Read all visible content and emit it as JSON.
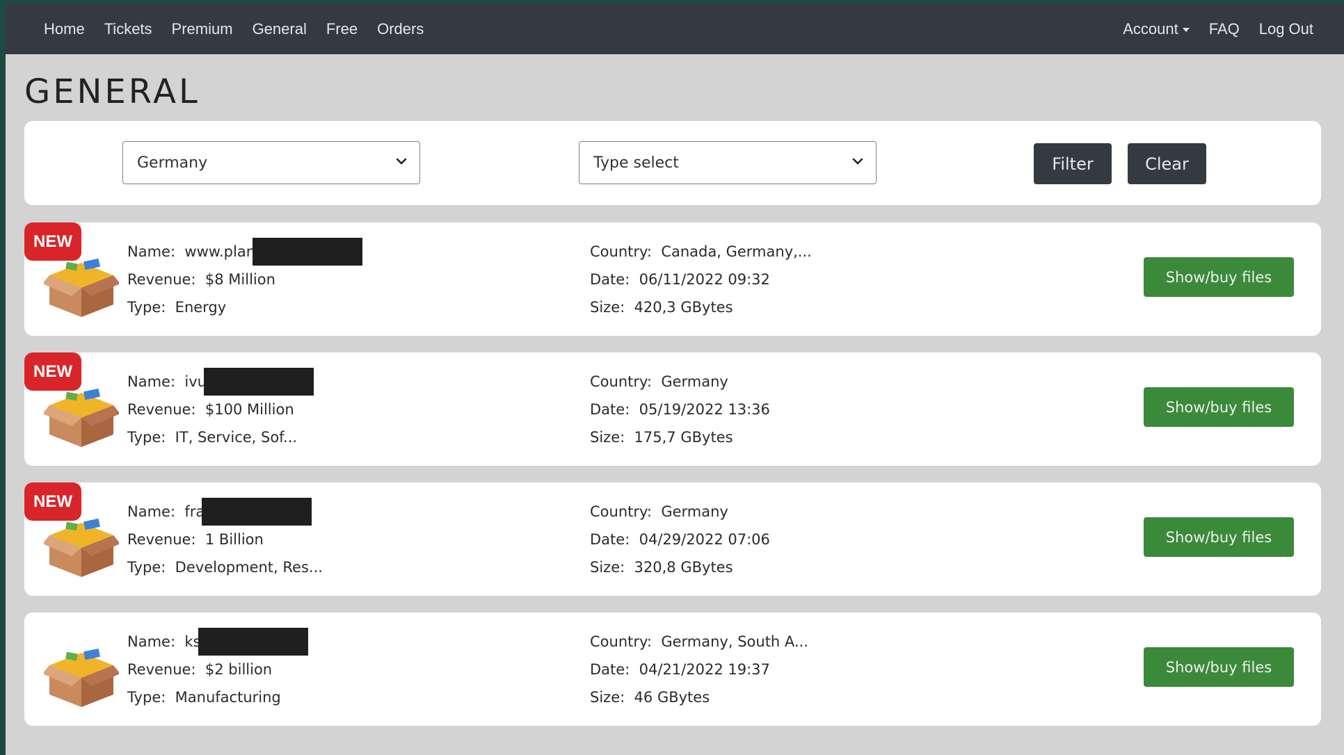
{
  "nav": {
    "left": [
      "Home",
      "Tickets",
      "Premium",
      "General",
      "Free",
      "Orders"
    ],
    "account": "Account",
    "faq": "FAQ",
    "logout": "Log Out"
  },
  "page_title": "GENERAL",
  "filters": {
    "country_selected": "Germany",
    "type_selected": "Type select",
    "filter_label": "Filter",
    "clear_label": "Clear"
  },
  "labels": {
    "name": "Name:",
    "revenue": "Revenue:",
    "type": "Type:",
    "country": "Country:",
    "date": "Date:",
    "size": "Size:"
  },
  "items": [
    {
      "badge": "NEW",
      "name": "www.plan",
      "revenue": "$8 Million",
      "type": "Energy",
      "country": "Canada, Germany,...",
      "date": "06/11/2022 09:32",
      "size": "420,3 GBytes",
      "button": "Show/buy files"
    },
    {
      "badge": "NEW",
      "name": "ivu",
      "revenue": "$100 Million",
      "type": "IT, Service, Sof...",
      "country": "Germany",
      "date": "05/19/2022 13:36",
      "size": "175,7 GBytes",
      "button": "Show/buy files"
    },
    {
      "badge": "NEW",
      "name": "fra",
      "revenue": "1 Billion",
      "type": "Development, Res...",
      "country": "Germany",
      "date": "04/29/2022 07:06",
      "size": "320,8 GBytes",
      "button": "Show/buy files"
    },
    {
      "badge": "",
      "name": "ks",
      "revenue": "$2 billion",
      "type": "Manufacturing",
      "country": "Germany, South A...",
      "date": "04/21/2022 19:37",
      "size": "46 GBytes",
      "button": "Show/buy files"
    }
  ],
  "colors": {
    "navbar": "#343a40",
    "new_badge": "#d9252a",
    "buy_button": "#3a8a3a",
    "background": "#d3d3d3"
  },
  "icons": {
    "item": "package-box-icon",
    "select": "chevron-down-icon"
  }
}
